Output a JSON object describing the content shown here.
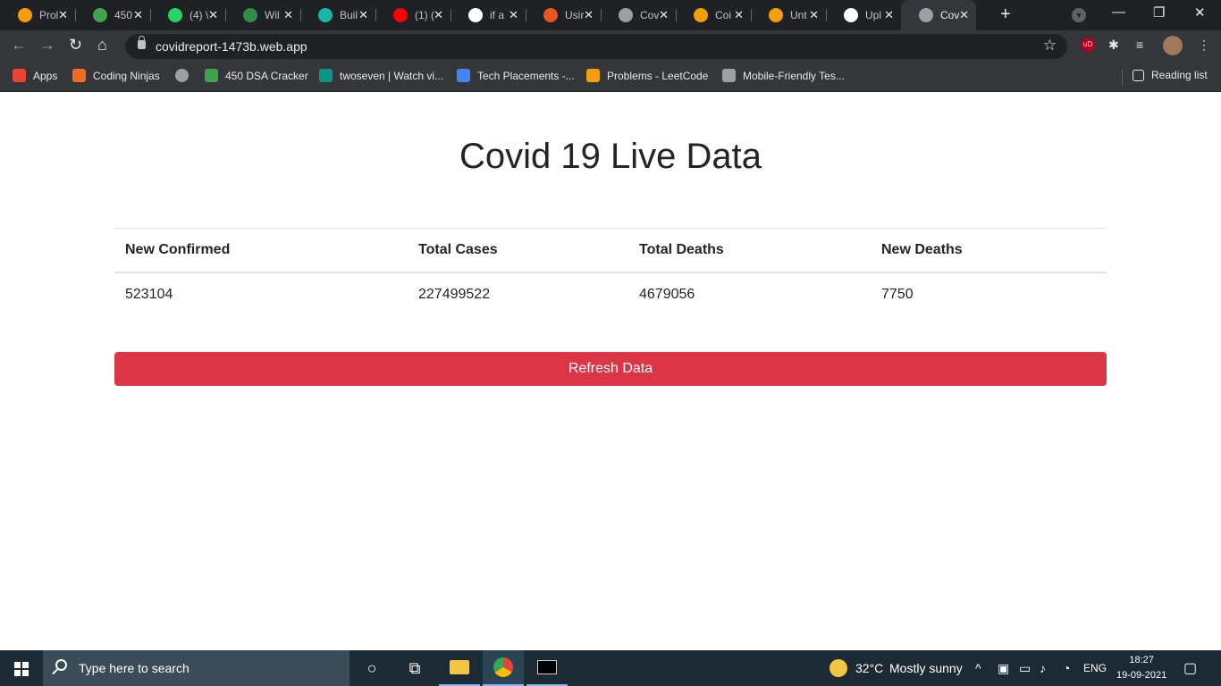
{
  "browser": {
    "tabs": [
      {
        "title": "Prol",
        "icon": "coding-ninjas-icon",
        "color": "#f59e0b"
      },
      {
        "title": "450",
        "icon": "dsa-icon",
        "color": "#3fa34d"
      },
      {
        "title": "(4) \\",
        "icon": "whatsapp-icon",
        "color": "#25d366"
      },
      {
        "title": "Wil",
        "icon": "geeksforgeeks-icon",
        "color": "#2f8d46"
      },
      {
        "title": "Buil",
        "icon": "diamond-icon",
        "color": "#14b8a6"
      },
      {
        "title": "(1) (",
        "icon": "youtube-icon",
        "color": "#ff0000"
      },
      {
        "title": "if a",
        "icon": "google-icon",
        "color": "#ffffff"
      },
      {
        "title": "Usir",
        "icon": "ubuntu-icon",
        "color": "#e95420"
      },
      {
        "title": "Cov",
        "icon": "globe-icon",
        "color": "#9aa0a6"
      },
      {
        "title": "Coi",
        "icon": "leetcode-icon",
        "color": "#f59e0b"
      },
      {
        "title": "Unt",
        "icon": "leetcode-icon",
        "color": "#f59e0b"
      },
      {
        "title": "Upl",
        "icon": "github-icon",
        "color": "#ffffff"
      },
      {
        "title": "Cov",
        "icon": "globe-icon",
        "color": "#9aa0a6",
        "active": true
      }
    ],
    "url": "covidreport-1473b.web.app"
  },
  "bookmarks": {
    "items": [
      {
        "label": "Apps",
        "icon": "apps-grid-icon",
        "color": "#ea4335"
      },
      {
        "label": "Coding Ninjas",
        "icon": "coding-ninjas-icon",
        "color": "#f26b21"
      },
      {
        "label": "",
        "icon": "globe-icon",
        "color": "#9aa0a6"
      },
      {
        "label": "450 DSA Cracker",
        "icon": "dsa-icon",
        "color": "#3fa34d"
      },
      {
        "label": "twoseven | Watch vi...",
        "icon": "twoseven-icon",
        "color": "#0d9488"
      },
      {
        "label": "Tech Placements -...",
        "icon": "docs-icon",
        "color": "#4285f4"
      },
      {
        "label": "Problems - LeetCode",
        "icon": "leetcode-icon",
        "color": "#f59e0b"
      },
      {
        "label": "Mobile-Friendly Tes...",
        "icon": "mobile-test-icon",
        "color": "#9aa0a6"
      }
    ],
    "reading_list": "Reading list"
  },
  "page": {
    "title": "Covid 19 Live Data",
    "table": {
      "headers": [
        "New Confirmed",
        "Total Cases",
        "Total Deaths",
        "New Deaths"
      ],
      "rows": [
        [
          "523104",
          "227499522",
          "4679056",
          "7750"
        ]
      ]
    },
    "refresh_label": "Refresh Data",
    "accent": "#dc3545"
  },
  "taskbar": {
    "search_placeholder": "Type here to search",
    "weather": {
      "temp": "32°C",
      "desc": "Mostly sunny"
    },
    "language": "ENG",
    "time": "18:27",
    "date": "19-09-2021"
  }
}
